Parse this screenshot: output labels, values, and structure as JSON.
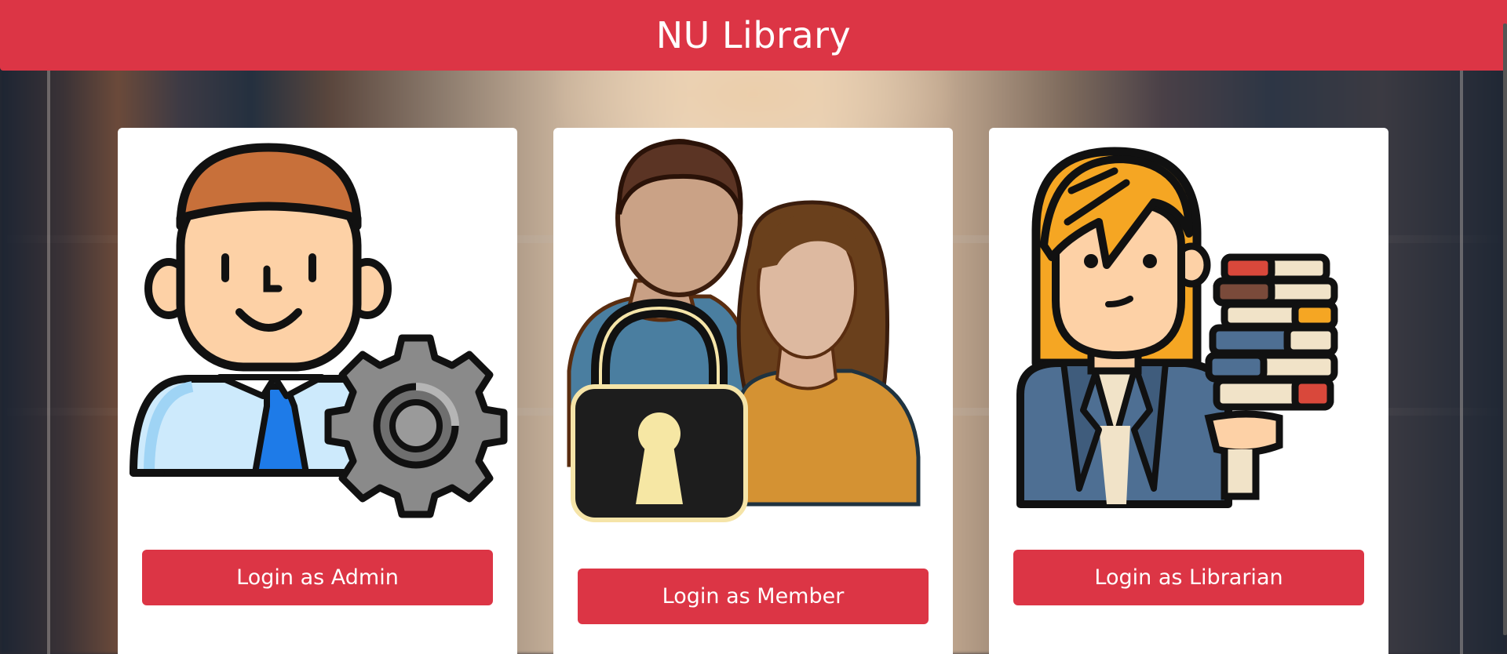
{
  "header": {
    "title": "NU Library"
  },
  "cards": [
    {
      "button_label": "Login as Admin",
      "illustration": "admin-with-gear-icon"
    },
    {
      "button_label": "Login as Member",
      "illustration": "members-with-padlock-icon"
    },
    {
      "button_label": "Login as Librarian",
      "illustration": "librarian-with-books-icon"
    }
  ],
  "colors": {
    "accent": "#dc3545",
    "card": "#ffffff"
  }
}
